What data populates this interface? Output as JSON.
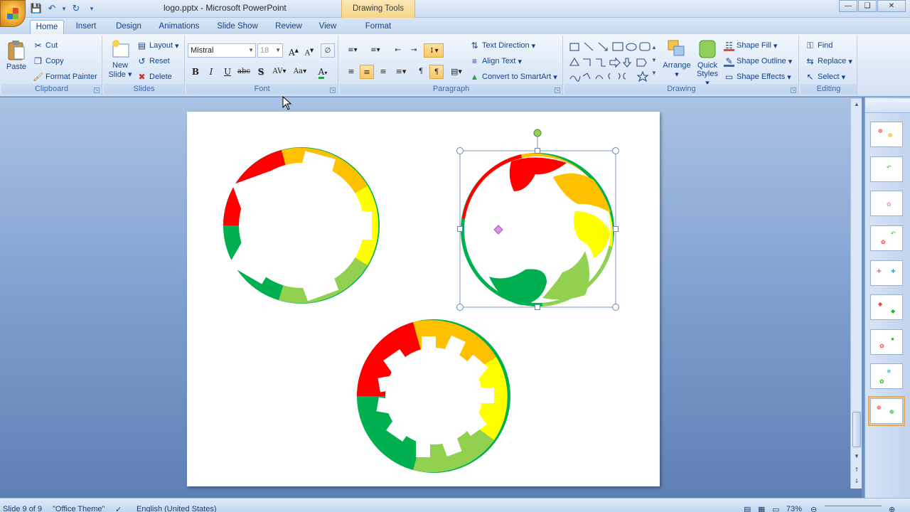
{
  "window": {
    "title": "logo.pptx - Microsoft PowerPoint",
    "context_tab_title": "Drawing Tools",
    "controls": [
      "minimize",
      "restore",
      "close"
    ]
  },
  "quick_access": [
    "save-icon",
    "undo-icon",
    "redo-icon",
    "customize-icon"
  ],
  "tabs": [
    {
      "label": "Home",
      "active": true
    },
    {
      "label": "Insert"
    },
    {
      "label": "Design"
    },
    {
      "label": "Animations"
    },
    {
      "label": "Slide Show"
    },
    {
      "label": "Review"
    },
    {
      "label": "View"
    },
    {
      "label": "Format"
    }
  ],
  "ribbon": {
    "clipboard": {
      "label": "Clipboard",
      "paste": "Paste",
      "cut": "Cut",
      "copy": "Copy",
      "format_painter": "Format Painter"
    },
    "slides": {
      "label": "Slides",
      "new_slide_1": "New",
      "new_slide_2": "Slide",
      "layout": "Layout",
      "reset": "Reset",
      "delete": "Delete"
    },
    "font": {
      "label": "Font",
      "font_name": "Mistral",
      "font_size": "18"
    },
    "paragraph": {
      "label": "Paragraph",
      "text_direction": "Text Direction",
      "align_text": "Align Text",
      "convert_smartart": "Convert to SmartArt"
    },
    "drawing": {
      "label": "Drawing",
      "arrange": "Arrange",
      "quick_styles_1": "Quick",
      "quick_styles_2": "Styles",
      "shape_fill": "Shape Fill",
      "shape_outline": "Shape Outline",
      "shape_effects": "Shape Effects"
    },
    "editing": {
      "label": "Editing",
      "find": "Find",
      "replace": "Replace",
      "select": "Select"
    }
  },
  "colors": {
    "red": "#ff0000",
    "orange": "#ffc000",
    "yellow": "#ffff00",
    "light_green": "#92d050",
    "green": "#00b050"
  },
  "slide_thumbnails_count": 9,
  "selected_thumbnail": 9,
  "status": {
    "slide": "Slide 9 of 9",
    "theme": "\"Office Theme\"",
    "language": "English (United States)",
    "zoom": "73%"
  }
}
